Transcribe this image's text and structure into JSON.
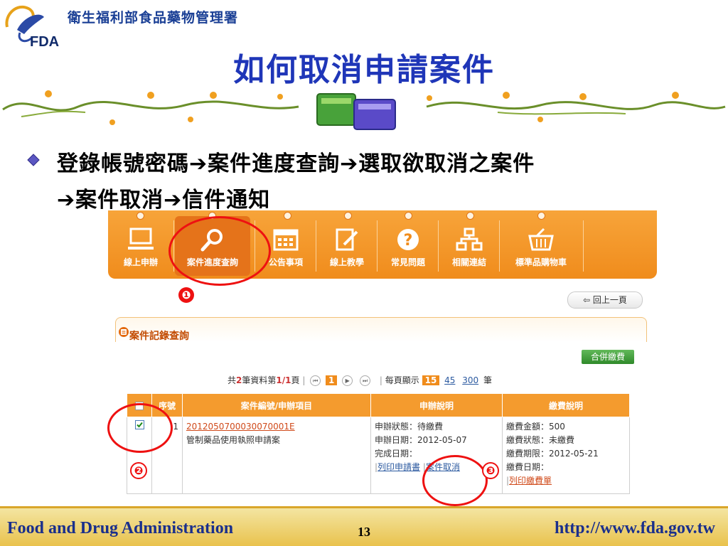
{
  "header": {
    "agency_name": "衛生福利部食品藥物管理署",
    "logo_text": "FDA",
    "slide_title": "如何取消申請案件"
  },
  "bullet": {
    "line1": "登錄帳號密碼➔案件進度查詢➔選取欲取消之案件",
    "line2": "➔案件取消➔信件通知"
  },
  "navbar": {
    "items": [
      {
        "label": "線上申辦",
        "icon": "monitor-icon"
      },
      {
        "label": "案件進度查詢",
        "icon": "search-icon"
      },
      {
        "label": "公告事項",
        "icon": "calendar-icon"
      },
      {
        "label": "線上教學",
        "icon": "edit-icon"
      },
      {
        "label": "常見問題",
        "icon": "question-icon"
      },
      {
        "label": "相關連結",
        "icon": "sitemap-icon"
      },
      {
        "label": "標準品購物車",
        "icon": "cart-icon"
      }
    ]
  },
  "back_button": "回上一頁",
  "panel": {
    "title": "案件記錄查詢",
    "merge_button": "合併繳費"
  },
  "pager": {
    "prefix": "共",
    "total": "2",
    "mid": "筆資料第",
    "page": "1/1",
    "suffix": "頁",
    "current": "1",
    "per_page_label": "每頁顯示",
    "sizes": [
      "15",
      "45",
      "300"
    ],
    "unit": "筆"
  },
  "table": {
    "headers": [
      "序號",
      "案件編號/申辦項目",
      "申辦說明",
      "繳費說明"
    ],
    "row": {
      "index": "1",
      "case_no": "2012050700030070001E",
      "case_item": "管制藥品使用執照申請案",
      "apply_status": "申辦狀態：待繳費",
      "apply_date": "申辦日期：2012-05-07",
      "finish_date": "完成日期：",
      "print_link": "列印申請書",
      "cancel_link": "案件取消",
      "fee_amount": "繳費金額：500",
      "fee_status": "繳費狀態：未繳費",
      "fee_deadline": "繳費期限：2012-05-21",
      "fee_date": "繳費日期：",
      "print_fee_link": "列印繳費單"
    }
  },
  "annotations": {
    "step1": "❶",
    "step2": "❷",
    "step3": "❸"
  },
  "footer": {
    "left": "Food and Drug Administration",
    "page_number": "13",
    "right": "http://www.fda.gov.tw"
  },
  "colors": {
    "title_blue": "#1f36b8",
    "nav_orange": "#f08c1c",
    "annotation_red": "#e11",
    "footer_gold": "#e9c24d"
  }
}
